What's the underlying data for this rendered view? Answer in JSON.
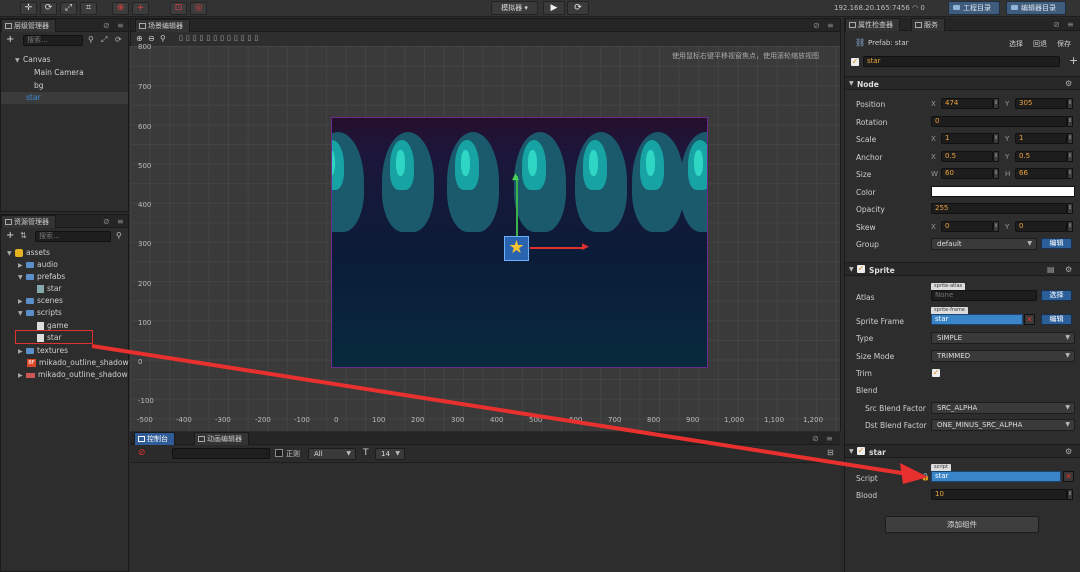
{
  "toolbar": {
    "preview_select": "模拟器 ▾",
    "ip": "192.168.20.165:7456",
    "wifi_count": "0",
    "project_dir": "工程目录",
    "editor_dir": "编辑器目录"
  },
  "hierarchy": {
    "tab": "层级管理器",
    "search_placeholder": "搜索...",
    "nodes": [
      "Canvas",
      "Main Camera",
      "bg",
      "star"
    ]
  },
  "assets": {
    "tab": "资源管理器",
    "search_placeholder": "搜索...",
    "items": [
      "assets",
      "audio",
      "prefabs",
      "star",
      "scenes",
      "scripts",
      "game",
      "star",
      "textures",
      "mikado_outline_shadow",
      "mikado_outline_shadow"
    ]
  },
  "scene": {
    "tab": "场景编辑器",
    "hint": "使用鼠标右键平移视窗焦点，使用滚轮缩放视图",
    "y_ticks": [
      "800",
      "700",
      "600",
      "500",
      "400",
      "300",
      "200",
      "100",
      "0",
      "-100"
    ],
    "x_ticks": [
      "-500",
      "-400",
      "-300",
      "-200",
      "-100",
      "0",
      "100",
      "200",
      "300",
      "400",
      "500",
      "600",
      "700",
      "800",
      "900",
      "1,000",
      "1,100",
      "1,200"
    ]
  },
  "console": {
    "tab_console": "控制台",
    "tab_anim": "动画编辑器",
    "regex_label": "正则",
    "level_select": "All",
    "font_size": "14"
  },
  "inspector": {
    "tab": "属性检查器",
    "tab2": "服务",
    "prefab_label": "Prefab:",
    "prefab_name": "star",
    "select_btn": "选择",
    "revert_btn": "回退",
    "save_btn": "保存",
    "node_name": "star",
    "node_section": "Node",
    "position": {
      "label": "Position",
      "x": "474",
      "y": "305"
    },
    "rotation": {
      "label": "Rotation",
      "value": "0"
    },
    "scale": {
      "label": "Scale",
      "x": "1",
      "y": "1"
    },
    "anchor": {
      "label": "Anchor",
      "x": "0.5",
      "y": "0.5"
    },
    "size": {
      "label": "Size",
      "w": "60",
      "h": "66"
    },
    "color_label": "Color",
    "opacity": {
      "label": "Opacity",
      "value": "255"
    },
    "skew": {
      "label": "Skew",
      "x": "0",
      "y": "0"
    },
    "group": {
      "label": "Group",
      "value": "default",
      "edit": "编辑"
    },
    "sprite_section": "Sprite",
    "atlas": {
      "label": "Atlas",
      "tag": "sprite-atlas",
      "value": "None",
      "btn": "选择"
    },
    "sprite_frame": {
      "label": "Sprite Frame",
      "tag": "sprite-frame",
      "value": "star",
      "btn": "编辑"
    },
    "type": {
      "label": "Type",
      "value": "SIMPLE"
    },
    "size_mode": {
      "label": "Size Mode",
      "value": "TRIMMED"
    },
    "trim_label": "Trim",
    "blend_label": "Blend",
    "src_blend": {
      "label": "Src Blend Factor",
      "value": "SRC_ALPHA"
    },
    "dst_blend": {
      "label": "Dst Blend Factor",
      "value": "ONE_MINUS_SRC_ALPHA"
    },
    "script_section": "star",
    "script": {
      "label": "Script",
      "tag": "script",
      "value": "star"
    },
    "blood": {
      "label": "Blood",
      "value": "10"
    },
    "add_component": "添加组件"
  },
  "colors": {
    "accent": "#2f5c96",
    "orange_value": "#f0a23b",
    "annotation_red": "#e8312f"
  }
}
